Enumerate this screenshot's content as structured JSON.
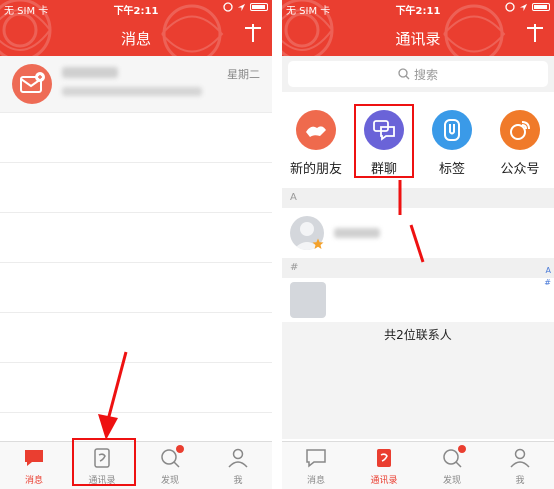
{
  "status_bar": {
    "carrier": "无 SIM 卡",
    "time": "下午2:11"
  },
  "left_screen": {
    "title": "消息",
    "message": {
      "time": "星期二"
    },
    "tabs": [
      {
        "label": "消息",
        "icon": "chat-bubble-icon",
        "active": true
      },
      {
        "label": "通讯录",
        "icon": "contacts-book-icon",
        "active": false
      },
      {
        "label": "发现",
        "icon": "discover-search-icon",
        "active": false,
        "badge": true
      },
      {
        "label": "我",
        "icon": "person-icon",
        "active": false
      }
    ]
  },
  "right_screen": {
    "title": "通讯录",
    "search_placeholder": "搜索",
    "quick_actions": [
      {
        "label": "新的朋友",
        "icon": "new-friend-icon",
        "color": "#ef6a4d"
      },
      {
        "label": "群聊",
        "icon": "group-chat-icon",
        "color": "#6a63d8"
      },
      {
        "label": "标签",
        "icon": "tag-icon",
        "color": "#3a9ae8"
      },
      {
        "label": "公众号",
        "icon": "official-account-icon",
        "color": "#f07a2a"
      }
    ],
    "sections": [
      "A",
      "#"
    ],
    "index_letters": [
      "A",
      "#"
    ],
    "footer": "共2位联系人",
    "tabs": [
      {
        "label": "消息",
        "icon": "chat-bubble-icon",
        "active": false
      },
      {
        "label": "通讯录",
        "icon": "contacts-book-icon",
        "active": true
      },
      {
        "label": "发现",
        "icon": "discover-search-icon",
        "active": false,
        "badge": true
      },
      {
        "label": "我",
        "icon": "person-icon",
        "active": false
      }
    ]
  },
  "colors": {
    "brand_red": "#ea3e30",
    "annotation_red": "#e11111"
  }
}
